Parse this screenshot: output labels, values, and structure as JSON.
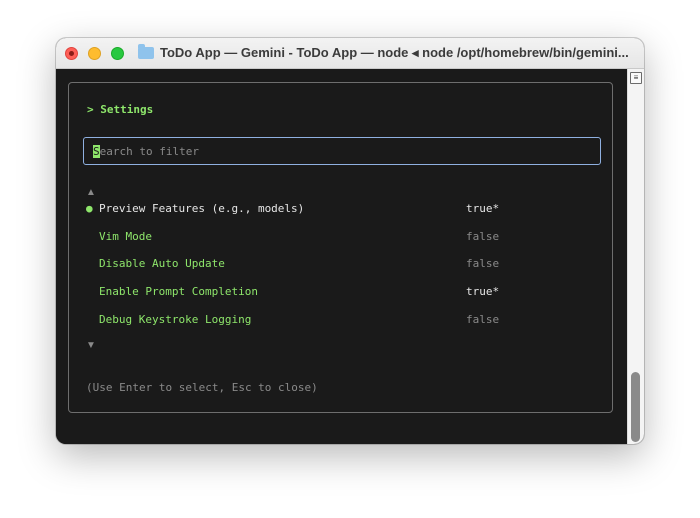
{
  "window": {
    "title": "ToDo App — Gemini - ToDo App — node ◂ node /opt/homebrew/bin/gemini..."
  },
  "settings": {
    "heading": "> Settings",
    "search": {
      "cursor_char": "S",
      "placeholder_rest": "earch to filter"
    },
    "scroll_up_indicator": "▲",
    "scroll_down_indicator": "▼",
    "items": [
      {
        "bullet": "●",
        "label": "Preview Features (e.g., models)",
        "value": "true*"
      },
      {
        "bullet": "",
        "label": "Vim Mode",
        "value": "false"
      },
      {
        "bullet": "",
        "label": "Disable Auto Update",
        "value": "false"
      },
      {
        "bullet": "",
        "label": "Enable Prompt Completion",
        "value": "true*"
      },
      {
        "bullet": "",
        "label": "Debug Keystroke Logging",
        "value": "false"
      }
    ],
    "hint": "(Use Enter to select, Esc to close)"
  },
  "colors": {
    "accent_green": "#8ee66b",
    "muted_gray": "#8a8a8a",
    "search_border": "#8fb0e0",
    "terminal_bg": "#1a1a1a"
  },
  "icons": {
    "title_folder": "folder-icon",
    "scroll_menu": "scroll-menu-icon"
  }
}
